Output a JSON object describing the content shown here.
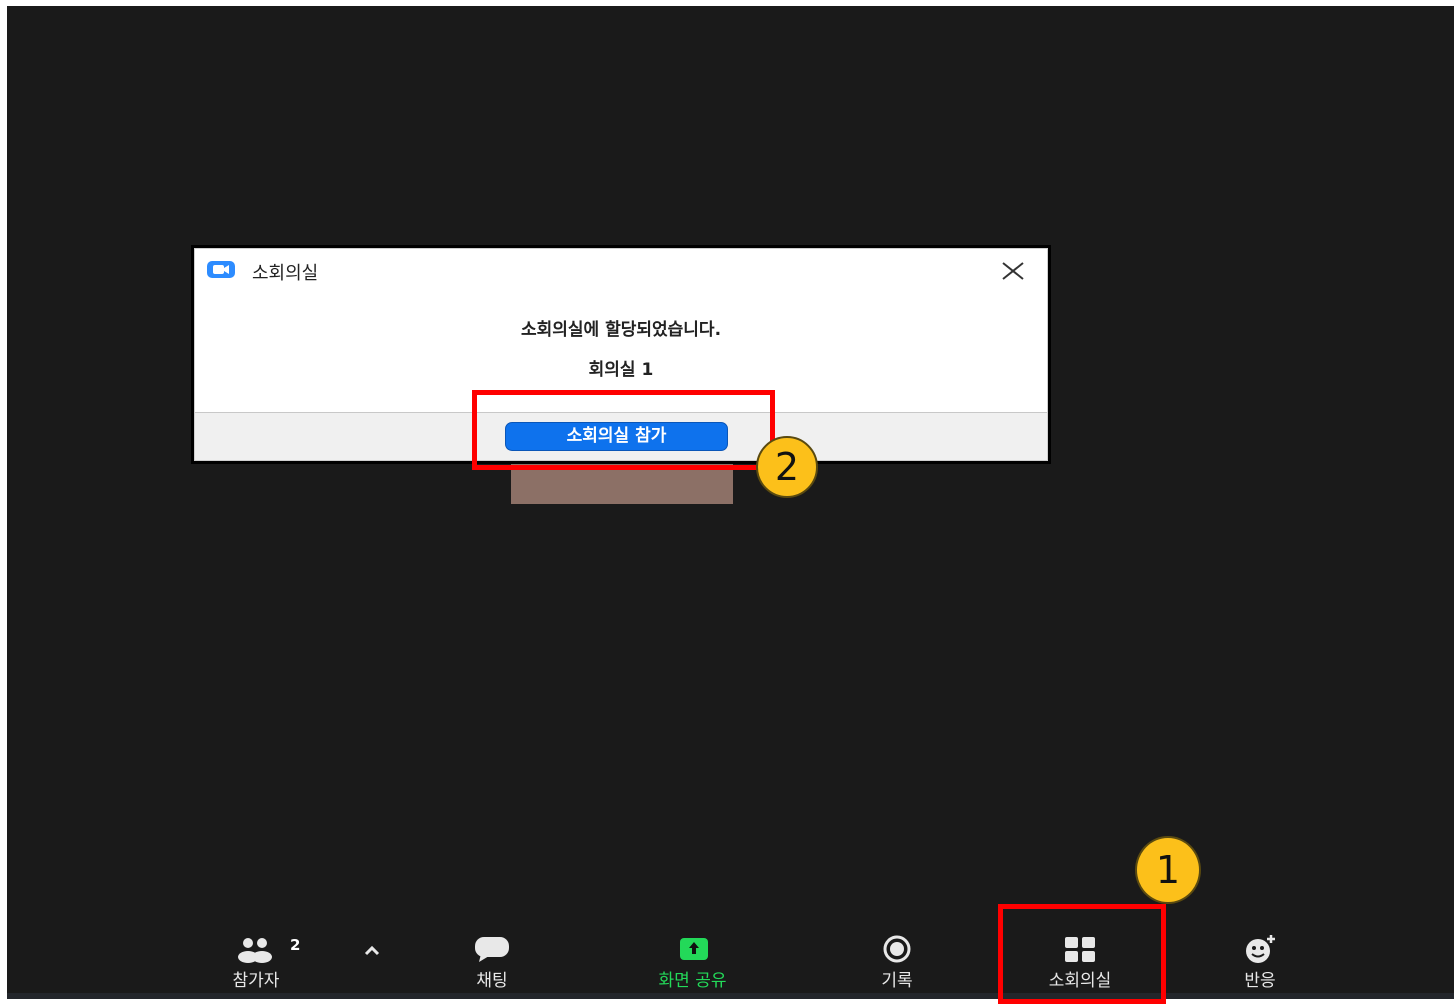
{
  "dialog": {
    "title": "소회의실",
    "message": "소회의실에 할당되었습니다.",
    "room_name": "회의실 1",
    "join_button": "소회의실 참가"
  },
  "toolbar": {
    "participants": {
      "label": "참가자",
      "count": "2"
    },
    "chat": {
      "label": "채팅"
    },
    "share_screen": {
      "label": "화면 공유"
    },
    "record": {
      "label": "기록"
    },
    "breakout_rooms": {
      "label": "소회의실"
    },
    "reactions": {
      "label": "반응"
    }
  },
  "annotations": {
    "step1": "1",
    "step2": "2"
  },
  "colors": {
    "background": "#1a1a1a",
    "accent_blue": "#0e72ed",
    "share_green": "#23d959",
    "highlight_red": "#ff0000",
    "marker_yellow": "#fcc01a"
  },
  "icons": [
    "zoom-logo-icon",
    "close-icon",
    "participants-icon",
    "chevron-up-icon",
    "chat-icon",
    "share-screen-icon",
    "record-icon",
    "breakout-rooms-icon",
    "reactions-icon"
  ]
}
